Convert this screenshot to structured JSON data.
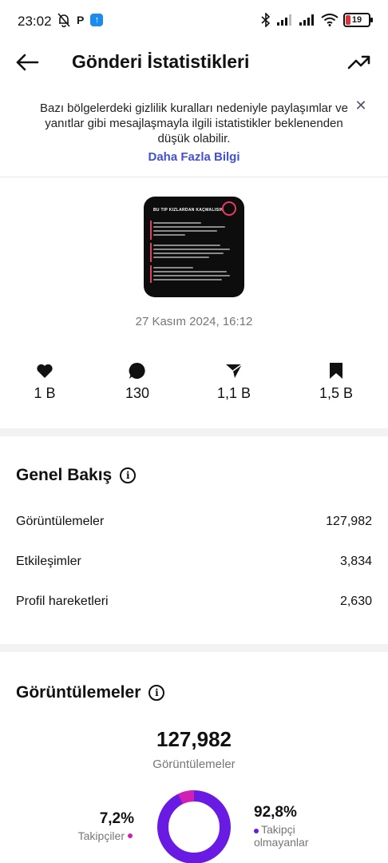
{
  "status_bar": {
    "time": "23:02",
    "battery": "19",
    "icons": [
      "bell-off-icon",
      "p-icon",
      "upload-app-icon",
      "bluetooth-icon",
      "signal-icon",
      "signal-icon",
      "wifi-icon",
      "battery-icon"
    ]
  },
  "header": {
    "title": "Gönderi İstatistikleri",
    "back_icon": "arrow-left-icon",
    "trend_icon": "trending-up-icon"
  },
  "notice": {
    "text": "Bazı bölgelerdeki gizlilik kuralları nedeniyle paylaşımlar ve yanıtlar gibi mesajlaşmayla ilgili istatistikler beklenenden düşük olabilir.",
    "link": "Daha Fazla Bilgi",
    "close_icon": "close-icon"
  },
  "post": {
    "thumbnail_title": "BU TIP KIZLARDAN KAÇMALISIN",
    "date": "27 Kasım 2024, 16:12"
  },
  "metrics": [
    {
      "icon": "heart-icon",
      "value": "1 B"
    },
    {
      "icon": "comment-icon",
      "value": "130"
    },
    {
      "icon": "share-icon",
      "value": "1,1 B"
    },
    {
      "icon": "bookmark-icon",
      "value": "1,5 B"
    }
  ],
  "overview": {
    "title": "Genel Bakış",
    "rows": [
      {
        "label": "Görüntülemeler",
        "value": "127,982"
      },
      {
        "label": "Etkileşimler",
        "value": "3,834"
      },
      {
        "label": "Profil hareketleri",
        "value": "2,630"
      }
    ]
  },
  "views": {
    "title": "Görüntülemeler",
    "total": "127,982",
    "total_label": "Görüntülemeler",
    "followers_pct": "7,2%",
    "followers_label": "Takipçiler",
    "non_followers_pct": "92,8%",
    "non_followers_label": "Takipçi olmayanlar",
    "followers_fraction": 0.072,
    "colors": {
      "followers": "#d21fb3",
      "non_followers": "#6a1be3"
    }
  },
  "colors": {
    "link": "#4150d6",
    "accent_red": "#e0303a"
  }
}
